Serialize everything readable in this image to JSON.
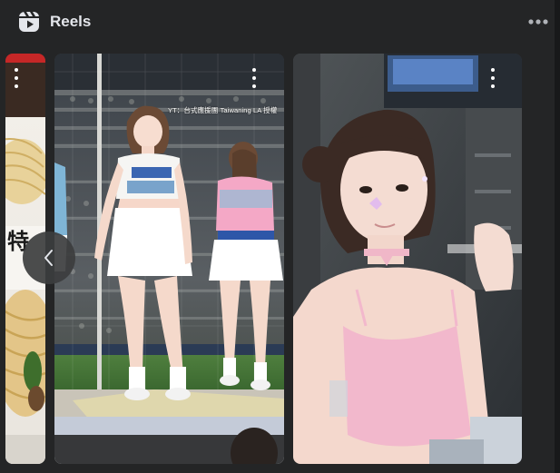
{
  "header": {
    "title": "Reels",
    "icon": "reels-icon",
    "more_icon": "more-horizontal-icon"
  },
  "carousel": {
    "prev_icon": "chevron-left-icon",
    "cards": [
      {
        "name": "reel-card-noodles",
        "image": "noodles",
        "partial": true
      },
      {
        "name": "reel-card-cheerleaders",
        "image": "cheerleaders-at-baseball-stadium",
        "watermark": "YT：台式應援團 Taiwaning LA 授權"
      },
      {
        "name": "reel-card-pink-top",
        "image": "woman-in-pink-top-at-stadium"
      }
    ]
  },
  "colors": {
    "panel_bg": "#242526",
    "page_bg": "#18191a",
    "title_text": "#e4e6eb",
    "icon": "#e4e6eb"
  }
}
